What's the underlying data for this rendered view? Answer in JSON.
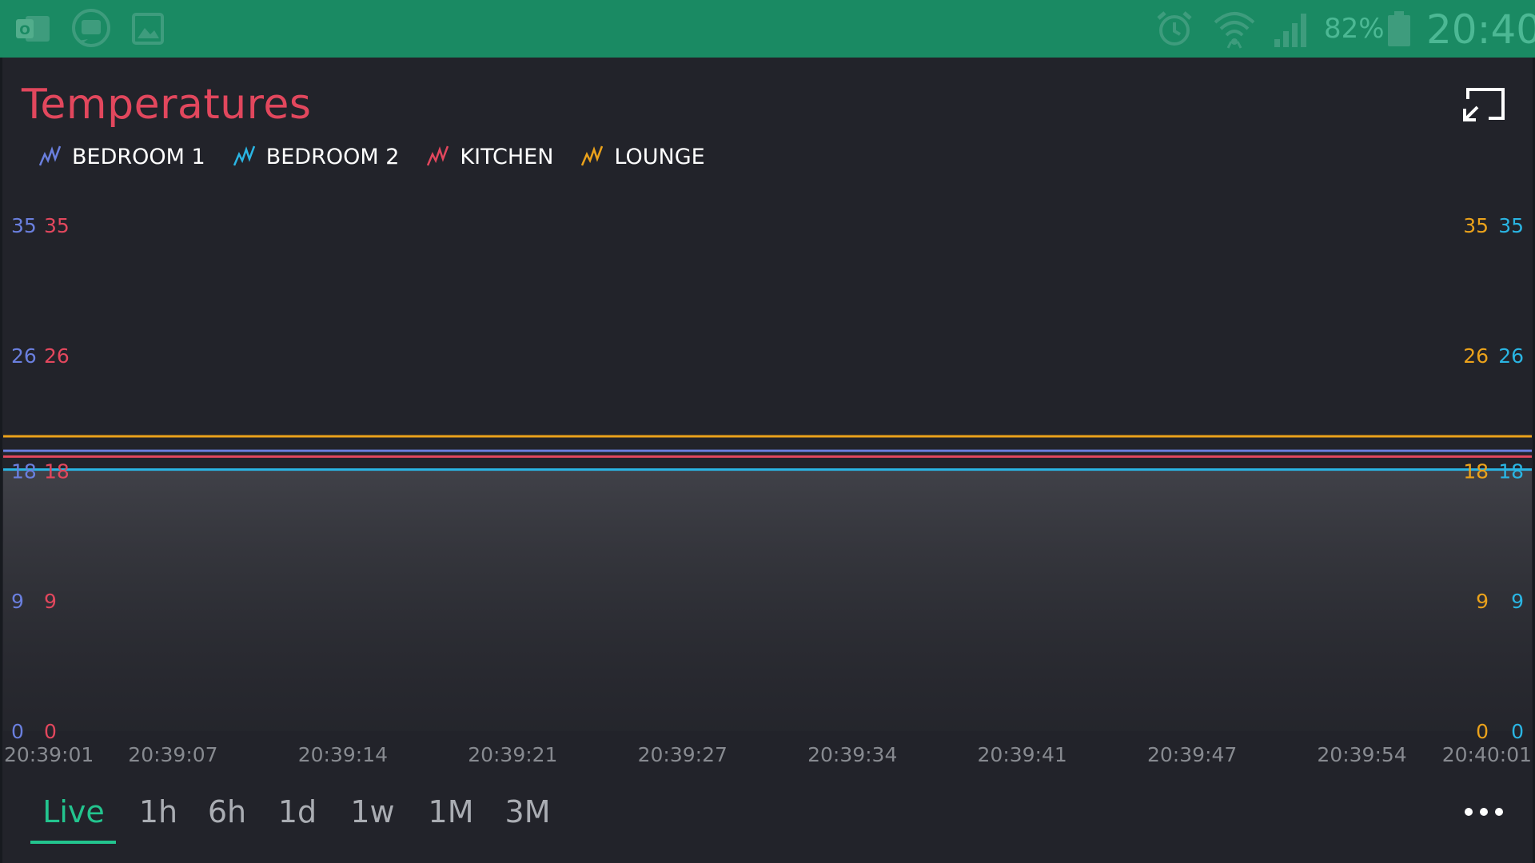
{
  "status_bar": {
    "left_icons": [
      "outlook-icon",
      "chat-icon",
      "gallery-icon"
    ],
    "right_icons": [
      "alarm-icon",
      "wifi-icon",
      "signal-icon",
      "battery-icon"
    ],
    "battery": "82%",
    "clock": "20:40"
  },
  "widget": {
    "title": "Temperatures",
    "fullscreen_icon": "exit-fullscreen-icon",
    "legend": [
      {
        "name": "BEDROOM 1",
        "color": "#6a7fde",
        "icon": "line-chart-icon"
      },
      {
        "name": "BEDROOM 2",
        "color": "#2ab5e3",
        "icon": "line-chart-icon"
      },
      {
        "name": "KITCHEN",
        "color": "#e2475d",
        "icon": "line-chart-icon"
      },
      {
        "name": "LOUNGE",
        "color": "#eba21b",
        "icon": "line-chart-icon"
      }
    ]
  },
  "chart_data": {
    "type": "line",
    "title": "Temperatures",
    "x": [
      "20:39:01",
      "20:39:07",
      "20:39:14",
      "20:39:21",
      "20:39:27",
      "20:39:34",
      "20:39:41",
      "20:39:47",
      "20:39:54",
      "20:40:01"
    ],
    "ylim": [
      0,
      35
    ],
    "y_ticks": [
      "0",
      "9",
      "18",
      "26",
      "35"
    ],
    "grid": false,
    "legend_position": "top-left",
    "series": [
      {
        "name": "BEDROOM 1",
        "color": "#6a7fde",
        "axis": "left-outer",
        "values": [
          19.4,
          19.4,
          19.4,
          19.4,
          19.4,
          19.4,
          19.4,
          19.4,
          19.4,
          19.4
        ]
      },
      {
        "name": "BEDROOM 2",
        "color": "#2ab5e3",
        "axis": "right-outer",
        "values": [
          18.1,
          18.1,
          18.1,
          18.1,
          18.1,
          18.1,
          18.1,
          18.1,
          18.1,
          18.1
        ]
      },
      {
        "name": "KITCHEN",
        "color": "#e2475d",
        "axis": "left-inner",
        "values": [
          19.0,
          19.0,
          19.0,
          19.0,
          19.0,
          19.0,
          19.0,
          19.0,
          19.0,
          19.0
        ]
      },
      {
        "name": "LOUNGE",
        "color": "#eba21b",
        "axis": "right-inner",
        "values": [
          20.4,
          20.4,
          20.4,
          20.4,
          20.4,
          20.4,
          20.4,
          20.4,
          20.4,
          20.4
        ]
      }
    ]
  },
  "period_tabs": {
    "items": [
      "Live",
      "1h",
      "6h",
      "1d",
      "1w",
      "1M",
      "3M"
    ],
    "active": "Live",
    "more_icon": "more-horizontal-icon"
  }
}
